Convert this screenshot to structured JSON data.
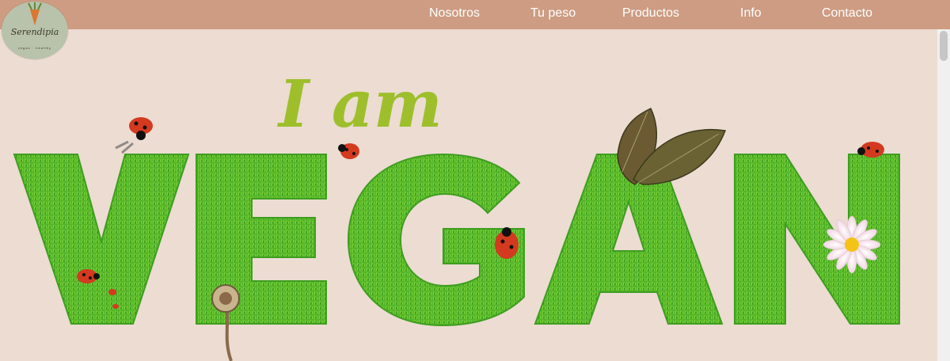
{
  "brand": {
    "name": "Serendipia",
    "tagline": "vegan · healthy"
  },
  "nav": {
    "items": [
      "Nosotros",
      "Tu peso",
      "Productos",
      "Info",
      "Contacto"
    ]
  },
  "hero": {
    "line1": "I am",
    "line2": "VEGAN",
    "line1_color": "#9ebf2b",
    "grass_color": "#55b52a"
  },
  "colors": {
    "navbar": "#cd9c82",
    "background": "#ecdcd2",
    "logo_bg": "#b9c2aa"
  }
}
